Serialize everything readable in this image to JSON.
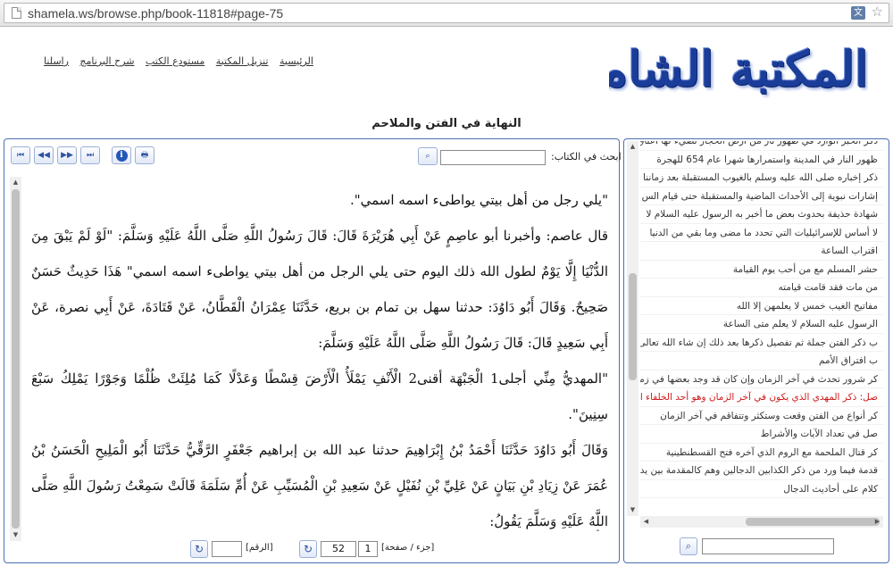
{
  "browser": {
    "url": "shamela.ws/browse.php/book-11818#page-75",
    "translate_icon": "translate-icon",
    "bookmark_icon": "star-icon"
  },
  "site": {
    "logo_text": "المكتبة الشاملة",
    "nav": [
      "الرئيسية",
      "تنزيل المكتبة",
      "مستودع الكتب",
      "شرح البرنامج",
      "راسلنا"
    ]
  },
  "book": {
    "title": "النهاية في الفتن والملاحم"
  },
  "toolbar": {
    "search_label": "ابحث في الكتاب:",
    "search_value": "",
    "buttons": [
      "first-page",
      "prev-page",
      "next-page",
      "last-page",
      "info",
      "print"
    ]
  },
  "content": {
    "paragraphs": [
      "\"يلي رجل من أهل بيتي يواطىء اسمه اسمي\".",
      "قال عاصم: وأخبرنا أبو عاصِمٍ عَنْ أَبِي هُرَيْرَةَ قَالَ: قَالَ رَسُولُ اللَّهِ صَلَّى اللَّهُ عَلَيْهِ وَسَلَّمَ: \"لَوْ لَمْ يَبْقَ مِنَ الدُّنْيَا إِلَّا يَوْمٌ لطول الله ذلك اليوم حتى يلي الرجل من أهل بيتي يواطىء اسمه اسمي\" هَذَا حَدِيثٌ حَسَنٌ صَحِيحٌ. وَقَالَ أَبُو دَاوُدَ: حدثنا سهل بن تمام بن بريع، حَدَّثَنَا عِمْرَانُ الْقَطَّانُ، عَنْ قَتَادَةَ، عَنْ أَبِي نصرة، عَنْ أَبِي سَعِيدٍ قَالَ: قَالَ رَسُولُ اللَّهِ صَلَّى اللَّهُ عَلَيْهِ وَسَلَّمَ:",
      "\"المهديُّ مِنِّي أجلى1 الْجَبْهَة أقنى2 الْأَنْفِ يَمْلَأُ الْأَرْضَ قِسْطًا وَعَدْلًا كَمَا مُلِئَتْ ظُلْمًا وَجَوْرًا يَمْلِكُ سَبْعَ سِنِينَ\".",
      "وَقَالَ أَبُو دَاوُدَ حَدَّثَنَا أَحْمَدُ بْنُ إِبْرَاهِيمَ حدثنا عبد الله بن إبراهيم جَعْفَرٍ الرَّقِّيُّ حَدَّثَنَا أَبُو الْمَلِيحِ الْحَسَنُ بْنُ عُمَرَ عَنْ زِيَادِ بْنِ بَيَانٍ عَنْ عَلِيِّ بْنِ نُفَيْلٍ عَنْ سَعِيدِ بْنِ الْمُسَيِّبِ عَنْ أُمِّ سَلَمَةَ قَالَتْ سَمِعْتُ رَسُولَ اللَّهِ صَلَّى اللَّهُ عَلَيْهِ وَسَلَّمَ يَقُولُ:"
    ],
    "continuation_mark": "ˆ"
  },
  "pagination": {
    "part_page_label": "[جزء / صفحة]",
    "part_value": "1",
    "page_value": "52",
    "number_label": "[الرقم]",
    "number_value": ""
  },
  "toc": {
    "items": [
      "ذكر الخبر الوارد في ظهور نار من أرض الحجاز تضيء لها أعناق",
      "ظهور النار في المدينة واستمرارها شهرا عام 654 للهجرة",
      "ذكر إخباره صلى الله عليه وسلم بالغيوب المستقبلة بعد زماننا",
      "إشارات نبوية إلى الأحداث الماضية والمستقبلة حتى قيام الس",
      "شهادة حذيفة بحدوث بعض ما أخبر به الرسول عليه السلام لا",
      "لا أساس للإسرائيليات التي تحدد ما مضى وما بقي من الدنيا",
      "اقتراب الساعة",
      "حشر المسلم مع من أحب يوم القيامة",
      "من مات فقد قامت قيامته",
      "مفاتيح الغيب خمس لا يعلمهن إلا الله",
      "الرسول عليه السلام لا يعلم متى الساعة",
      "ب ذكر الفتن جملة ثم تفصيل ذكرها بعد ذلك إن شاء الله تعالى",
      "ب افتراق الأمم",
      "كر شرور تحدث في آخر الزمان وإن كان قد وجد بعضها في زماننا",
      "صل: ذكر المهدي الذي يكون في آخر الزمان وهو أحد الخلفاء الرا",
      "كر أنواع من الفتن وقعت وستكثر وتتفاقم في آخر الزمان",
      "صل في تعداد الآيات والأشراط",
      "كر قتال الملحمة مع الروم الذي آخره فتح القسطنطينية",
      "قدمة فيما ورد من ذكر الكذابين الدجالين وهم كالمقدمة بين يدي",
      "كلام على أحاديث الدجال"
    ],
    "selected_index": 14,
    "search_value": ""
  },
  "colors": {
    "panel_border": "#4d6fb3",
    "selected_toc": "#d01a1a",
    "logo": "#1a3d9a"
  }
}
